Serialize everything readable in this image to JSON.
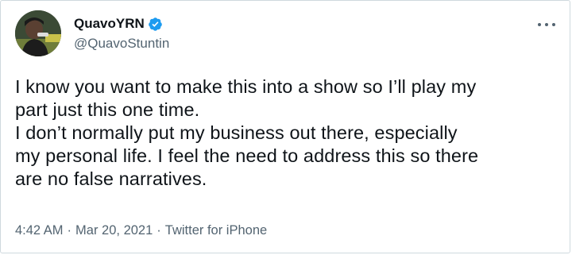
{
  "author": {
    "display_name": "QuavoYRN",
    "handle": "@QuavoStuntin",
    "verified": true,
    "avatar_icon": "profile-photo"
  },
  "tweet": {
    "lines": [
      "I know you want to make this into a show so I’ll play my",
      "part just this one time.",
      "I don’t normally put my business out there, especially",
      "my personal life. I feel the need to address this so there",
      "are no false narratives."
    ]
  },
  "meta": {
    "time": "4:42 AM",
    "date": "Mar 20, 2021",
    "source": "Twitter for iPhone",
    "separator": "·"
  },
  "colors": {
    "text": "#0f1419",
    "secondary": "#536471",
    "verified": "#1d9bf0",
    "border": "#cfd9de"
  }
}
